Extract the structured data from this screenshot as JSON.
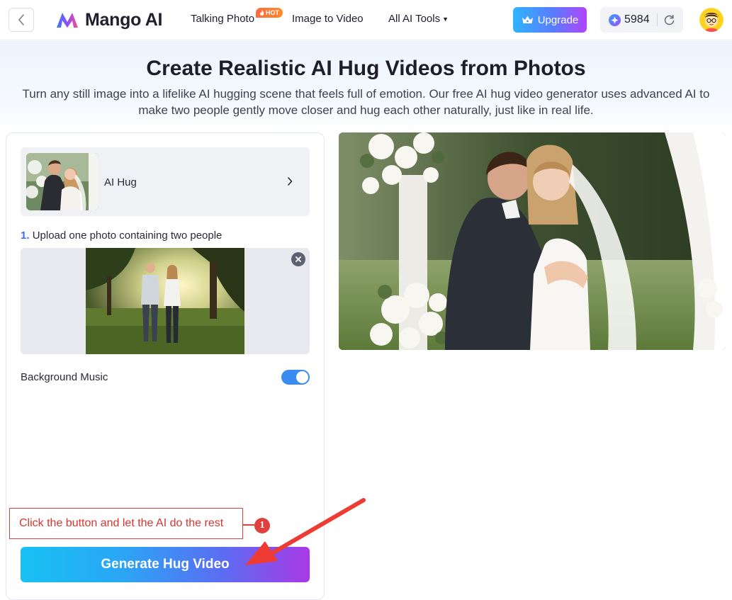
{
  "header": {
    "logo_text": "Mango AI",
    "nav": [
      {
        "label": "Talking Photo",
        "badge": "HOT"
      },
      {
        "label": "Image to Video"
      },
      {
        "label": "All AI Tools"
      }
    ],
    "upgrade_label": "Upgrade",
    "credits": "5984"
  },
  "hero": {
    "title": "Create Realistic AI Hug Videos from Photos",
    "subtitle": "Turn any still image into a lifelike AI hugging scene that feels full of emotion. Our free AI hug video generator uses advanced AI to make two people gently move closer and hug each other naturally, just like in real life."
  },
  "panel": {
    "effect_label": "AI Hug",
    "step_number": "1.",
    "step_text": "Upload one photo containing two people",
    "bgm_label": "Background Music",
    "bgm_enabled": true,
    "generate_label": "Generate Hug Video"
  },
  "annotation": {
    "text": "Click the button and let the AI do the rest",
    "number": "1"
  },
  "colors": {
    "accent_blue": "#3a8bf2",
    "annotation_red": "#e0403b",
    "hot_orange": "#ff6a3d"
  }
}
